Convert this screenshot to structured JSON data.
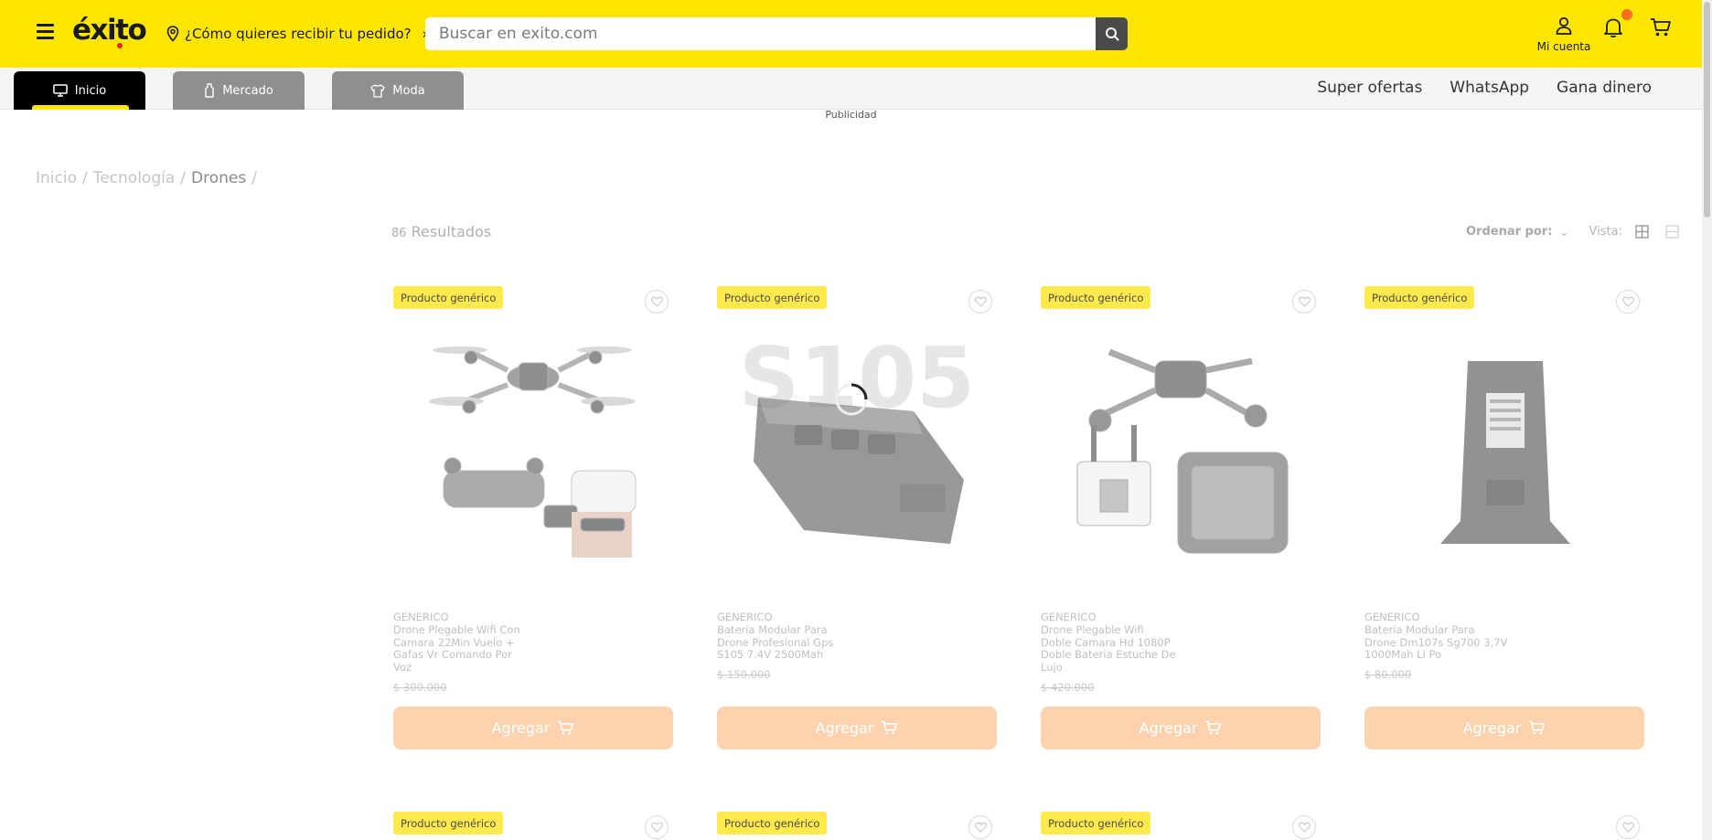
{
  "header": {
    "logo_text": "éxito",
    "location_prompt": "¿Cómo quieres recibir tu pedido?",
    "search_placeholder": "Buscar en exito.com",
    "account_label": "Mi cuenta",
    "brand_yellow": "#ffe600",
    "notification_dot_color": "#f36f21"
  },
  "nav": {
    "tabs": [
      {
        "label": "Inicio",
        "icon": "monitor-icon",
        "active": true
      },
      {
        "label": "Mercado",
        "icon": "bottle-icon",
        "active": false
      },
      {
        "label": "Moda",
        "icon": "shirt-icon",
        "active": false
      }
    ],
    "links": [
      "Super ofertas",
      "WhatsApp",
      "Gana dinero"
    ]
  },
  "ad_label": "Publicidad",
  "breadcrumb": {
    "items": [
      "Inicio",
      "Tecnología",
      "Drones"
    ],
    "separator": "/"
  },
  "results": {
    "count": "86",
    "label": "Resultados"
  },
  "sort": {
    "label": "Ordenar por:",
    "view_label": "Vista:"
  },
  "products": [
    {
      "badge": "Producto genérico",
      "brand": "GENERICO",
      "title_lines": [
        "Drone Plegable Wifi Con",
        "Camara 22Min Vuelo +",
        "Gafas Vr Comando Por",
        "Voz"
      ],
      "price": "$ 300.000",
      "button": "Agregar"
    },
    {
      "badge": "Producto genérico",
      "brand": "GENERICO",
      "title_lines": [
        "Batería Modular Para",
        "Drone Profesional Gps",
        "S105 7.4V 2500Mah"
      ],
      "price": "$ 150.000",
      "button": "Agregar",
      "image_text": "S105"
    },
    {
      "badge": "Producto genérico",
      "brand": "GENERICO",
      "title_lines": [
        "Drone Plegable Wifi",
        "Doble Camara Hd 1080P",
        "Doble Bateria Estuche De",
        "Lujo"
      ],
      "price": "$ 420.000",
      "button": "Agregar"
    },
    {
      "badge": "Producto genérico",
      "brand": "GENERICO",
      "title_lines": [
        "Batería Modular Para",
        "Drone Dm107s Sg700 3,7V",
        "1000Mah Li Po"
      ],
      "price": "$ 80.000",
      "button": "Agregar"
    }
  ],
  "products_row2": [
    {
      "badge": "Producto genérico"
    },
    {
      "badge": "Producto genérico"
    },
    {
      "badge": "Producto genérico"
    },
    {
      "badge": ""
    }
  ]
}
